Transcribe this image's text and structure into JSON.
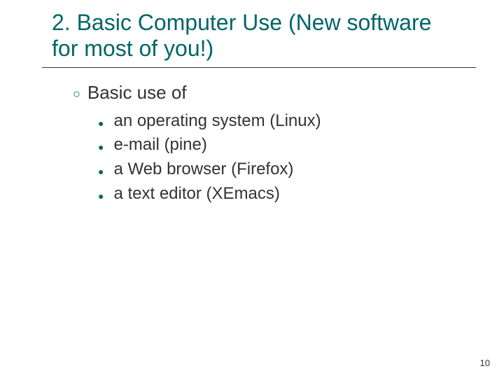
{
  "slide": {
    "title": "2. Basic Computer Use (New software for most of you!)",
    "heading": "Basic use of",
    "items": [
      "an operating system (Linux)",
      "e-mail (pine)",
      "a Web browser (Firefox)",
      "a text editor (XEmacs)"
    ],
    "page_number": "10"
  }
}
